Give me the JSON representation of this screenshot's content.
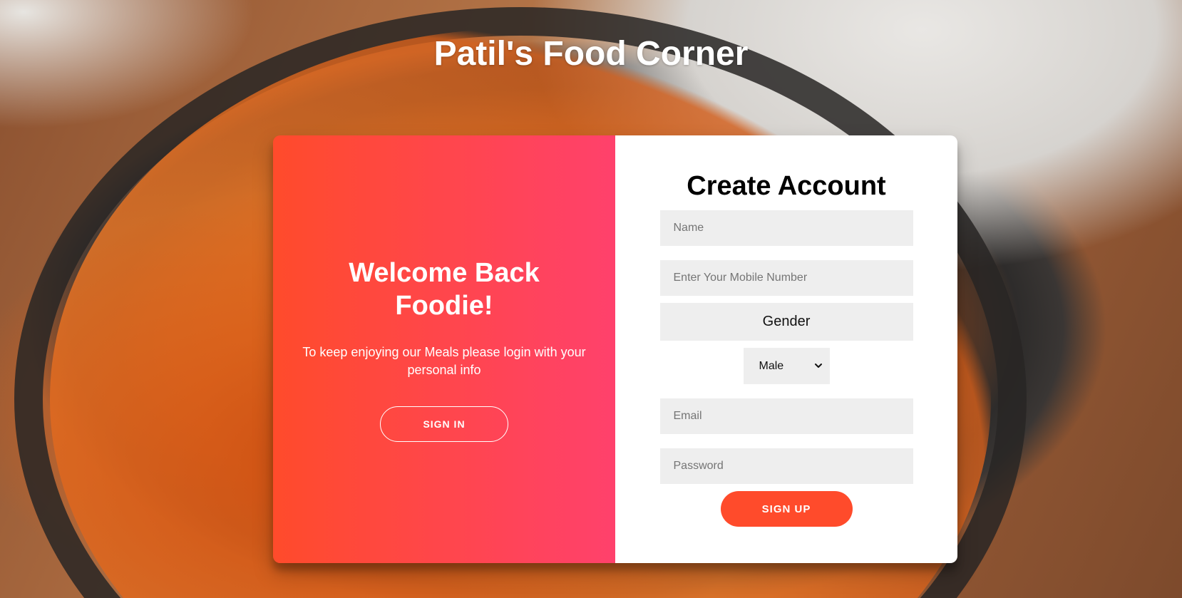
{
  "header": {
    "title": "Patil's Food Corner"
  },
  "overlay": {
    "title": "Welcome Back Foodie!",
    "message": "To keep enjoying our Meals please login with your personal info",
    "sign_in_label": "Sign In"
  },
  "signup_form": {
    "title": "Create Account",
    "name_placeholder": "Name",
    "mobile_placeholder": "Enter Your Mobile Number",
    "gender_label": "Gender",
    "gender_selected": "Male",
    "email_placeholder": "Email",
    "password_placeholder": "Password",
    "sign_up_label": "Sign Up"
  },
  "theme": {
    "accent": "#ff4b2b",
    "accent_end": "#ff416c",
    "input_bg": "#eeeeee"
  }
}
